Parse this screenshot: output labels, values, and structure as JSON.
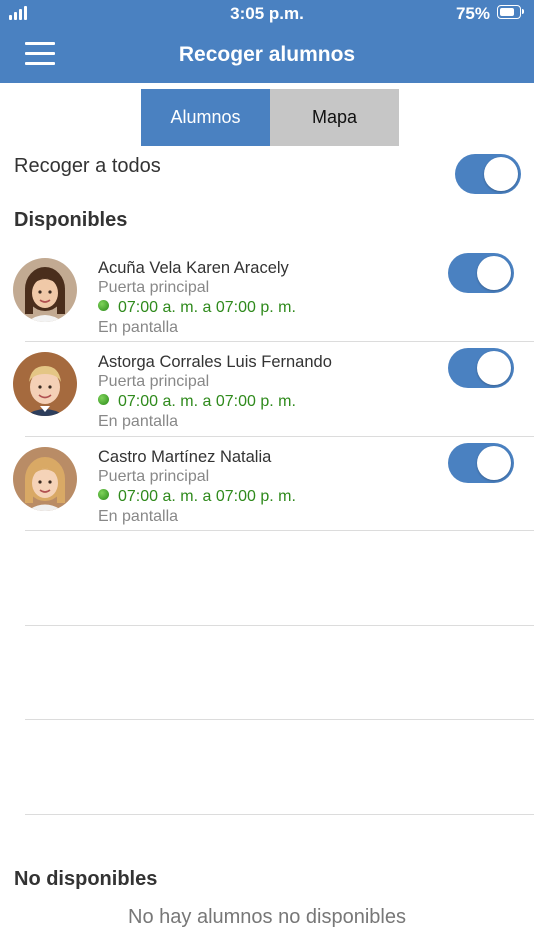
{
  "status_bar": {
    "time": "3:05 p.m.",
    "battery": "75%"
  },
  "header": {
    "title": "Recoger alumnos"
  },
  "segments": {
    "alumnos": "Alumnos",
    "mapa": "Mapa"
  },
  "recoger_todos": {
    "label": "Recoger a todos",
    "on": true
  },
  "disponibles_title": "Disponibles",
  "students": [
    {
      "name": "Acuña Vela Karen Aracely",
      "door": "Puerta principal",
      "schedule": "07:00 a. m. a 07:00 p. m.",
      "status": "En pantalla",
      "on": true
    },
    {
      "name": "Astorga Corrales Luis Fernando",
      "door": "Puerta principal",
      "schedule": "07:00 a. m. a 07:00 p. m.",
      "status": "En pantalla",
      "on": true
    },
    {
      "name": "Castro Martínez Natalia",
      "door": "Puerta principal",
      "schedule": "07:00 a. m. a 07:00 p. m.",
      "status": "En pantalla",
      "on": true
    }
  ],
  "no_disponibles_title": "No disponibles",
  "no_disponibles_empty": "No hay alumnos no disponibles",
  "colors": {
    "primary": "#4a81c1",
    "segment_inactive": "#c6c6c6",
    "schedule_green": "#2f8a1c"
  }
}
